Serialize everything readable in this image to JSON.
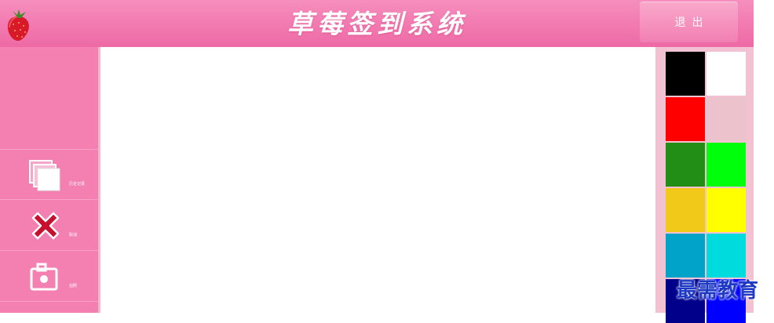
{
  "header": {
    "title": "草莓签到系统",
    "logout_label": "退出"
  },
  "sidebar": {
    "buttons": [
      {
        "label": "历史记录",
        "icon": "history-icon"
      },
      {
        "label": "取消",
        "icon": "cancel-x-icon"
      },
      {
        "label": "拍照",
        "icon": "camera-icon"
      }
    ]
  },
  "palette": {
    "colors": [
      "#000000",
      "#ffffff",
      "#ff0000",
      "#ecc3cc",
      "#238e15",
      "#00ff0b",
      "#f1c919",
      "#ffff00",
      "#01a3c9",
      "#00dcde",
      "#00008b",
      "#0000ff"
    ]
  },
  "watermark": "最需教育",
  "colors": {
    "header": "#f27bb1",
    "sidebar": "#f47fb1",
    "palette_bg": "#f3c2d2"
  }
}
